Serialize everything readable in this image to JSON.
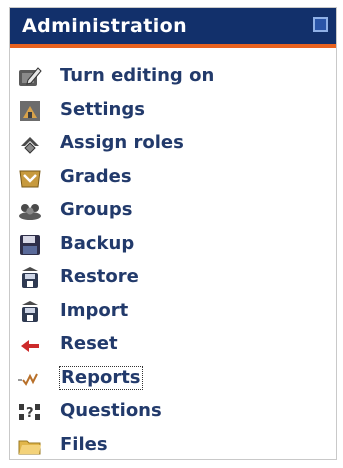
{
  "block": {
    "title": "Administration"
  },
  "menu": {
    "items": [
      {
        "label": "Turn editing on",
        "icon": "edit-icon"
      },
      {
        "label": "Settings",
        "icon": "settings-icon"
      },
      {
        "label": "Assign roles",
        "icon": "assign-roles-icon"
      },
      {
        "label": "Grades",
        "icon": "grades-icon"
      },
      {
        "label": "Groups",
        "icon": "groups-icon"
      },
      {
        "label": "Backup",
        "icon": "backup-icon"
      },
      {
        "label": "Restore",
        "icon": "restore-icon"
      },
      {
        "label": "Import",
        "icon": "import-icon"
      },
      {
        "label": "Reset",
        "icon": "reset-icon"
      },
      {
        "label": "Reports",
        "icon": "reports-icon"
      },
      {
        "label": "Questions",
        "icon": "questions-icon"
      },
      {
        "label": "Files",
        "icon": "files-icon"
      }
    ]
  },
  "colors": {
    "header_bg": "#12306b",
    "header_rule": "#e8621f",
    "link": "#223a6b"
  }
}
